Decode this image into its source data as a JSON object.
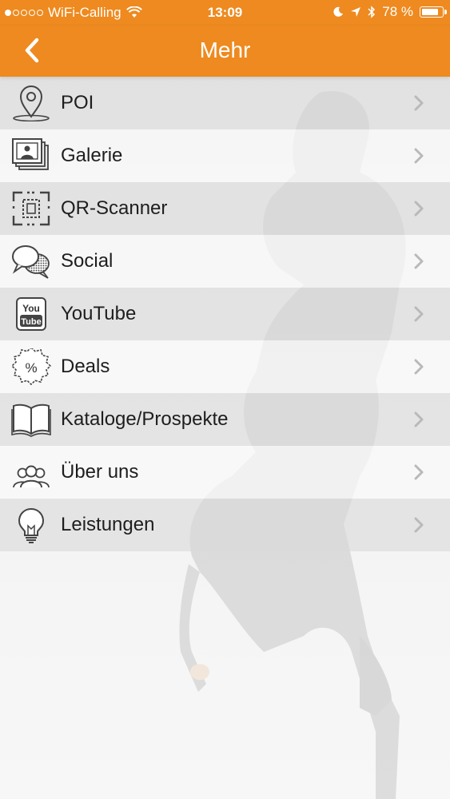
{
  "status_bar": {
    "carrier": "WiFi-Calling",
    "time": "13:09",
    "battery_percent": "78 %",
    "signal_dots_filled": 1,
    "signal_dots_total": 5
  },
  "nav": {
    "title": "Mehr",
    "back_icon": "chevron-left-icon"
  },
  "menu": {
    "items": [
      {
        "label": "POI",
        "icon": "map-pin-icon"
      },
      {
        "label": "Galerie",
        "icon": "photo-gallery-icon"
      },
      {
        "label": "QR-Scanner",
        "icon": "qr-scanner-icon"
      },
      {
        "label": "Social",
        "icon": "speech-bubbles-icon"
      },
      {
        "label": "YouTube",
        "icon": "youtube-icon"
      },
      {
        "label": "Deals",
        "icon": "percent-badge-icon"
      },
      {
        "label": "Kataloge/Prospekte",
        "icon": "open-book-icon"
      },
      {
        "label": "Über uns",
        "icon": "people-group-icon"
      },
      {
        "label": "Leistungen",
        "icon": "lightbulb-icon"
      }
    ]
  },
  "colors": {
    "accent": "#ee8a1f",
    "row_dark": "#dadada",
    "row_light": "#fafafa",
    "text": "#1e1e1e",
    "chevron": "#b9b9b9"
  }
}
